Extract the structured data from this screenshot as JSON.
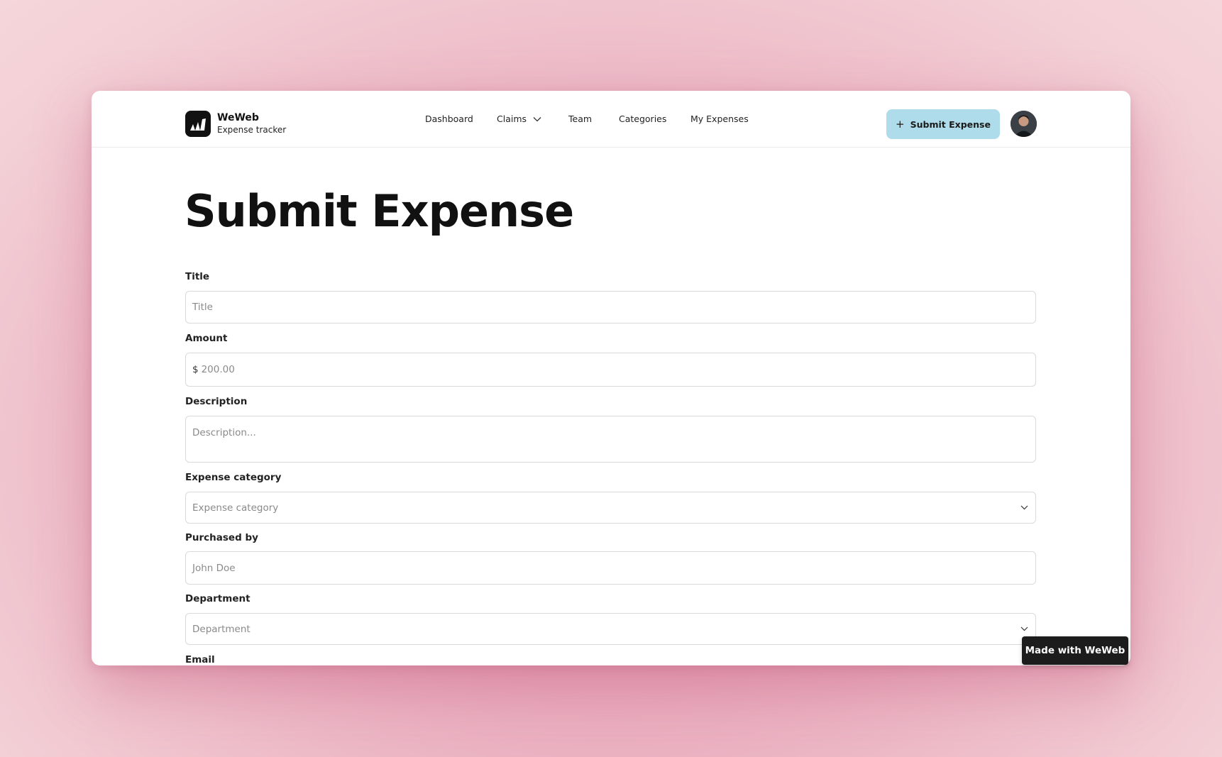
{
  "brand": {
    "name": "WeWeb",
    "subtitle": "Expense tracker"
  },
  "nav": {
    "items": [
      {
        "label": "Dashboard"
      },
      {
        "label": "Claims",
        "has_dropdown": true
      },
      {
        "label": "Team"
      },
      {
        "label": "Categories"
      },
      {
        "label": "My Expenses"
      }
    ]
  },
  "header": {
    "cta_label": "Submit Expense",
    "cta_icon": "plus-icon"
  },
  "page": {
    "title": "Submit Expense"
  },
  "form": {
    "title": {
      "label": "Title",
      "placeholder": "Title"
    },
    "amount": {
      "label": "Amount",
      "currency": "$",
      "placeholder": "200.00"
    },
    "description": {
      "label": "Description",
      "placeholder": "Description..."
    },
    "category": {
      "label": "Expense category",
      "placeholder": "Expense category"
    },
    "purchased_by": {
      "label": "Purchased by",
      "placeholder": "John Doe"
    },
    "department": {
      "label": "Department",
      "placeholder": "Department"
    },
    "email": {
      "label": "Email"
    }
  },
  "badge": {
    "label": "Made with WeWeb"
  },
  "colors": {
    "accent": "#aedcea",
    "background": "#eab0c0",
    "text": "#111111"
  }
}
